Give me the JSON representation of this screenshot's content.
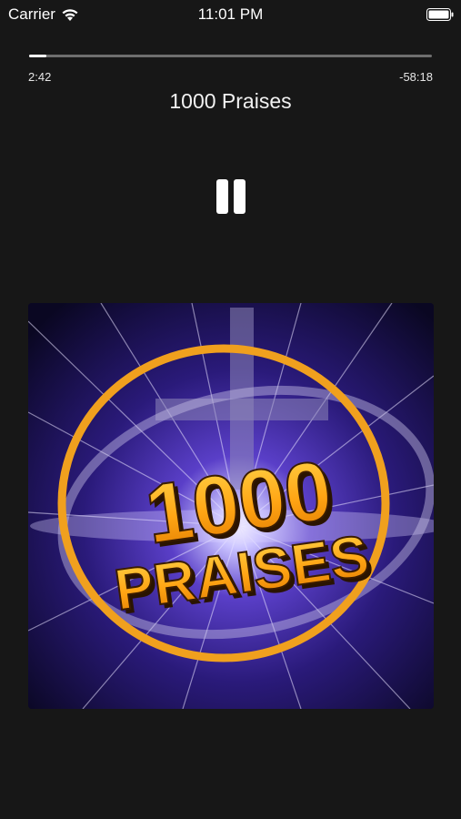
{
  "status_bar": {
    "carrier": "Carrier",
    "time": "11:01 PM",
    "icons": [
      "wifi-icon",
      "battery-icon"
    ]
  },
  "player": {
    "progress_fraction": 0.044,
    "elapsed": "2:42",
    "remaining": "-58:18",
    "title": "1000 Praises",
    "control_icon": "pause-icon"
  },
  "artwork": {
    "logo_line1": "1000",
    "logo_line2": "PRAISES",
    "colors": {
      "background": "#1a0f4a",
      "ring": "#f0a01e",
      "text": "#ffb21c"
    }
  }
}
